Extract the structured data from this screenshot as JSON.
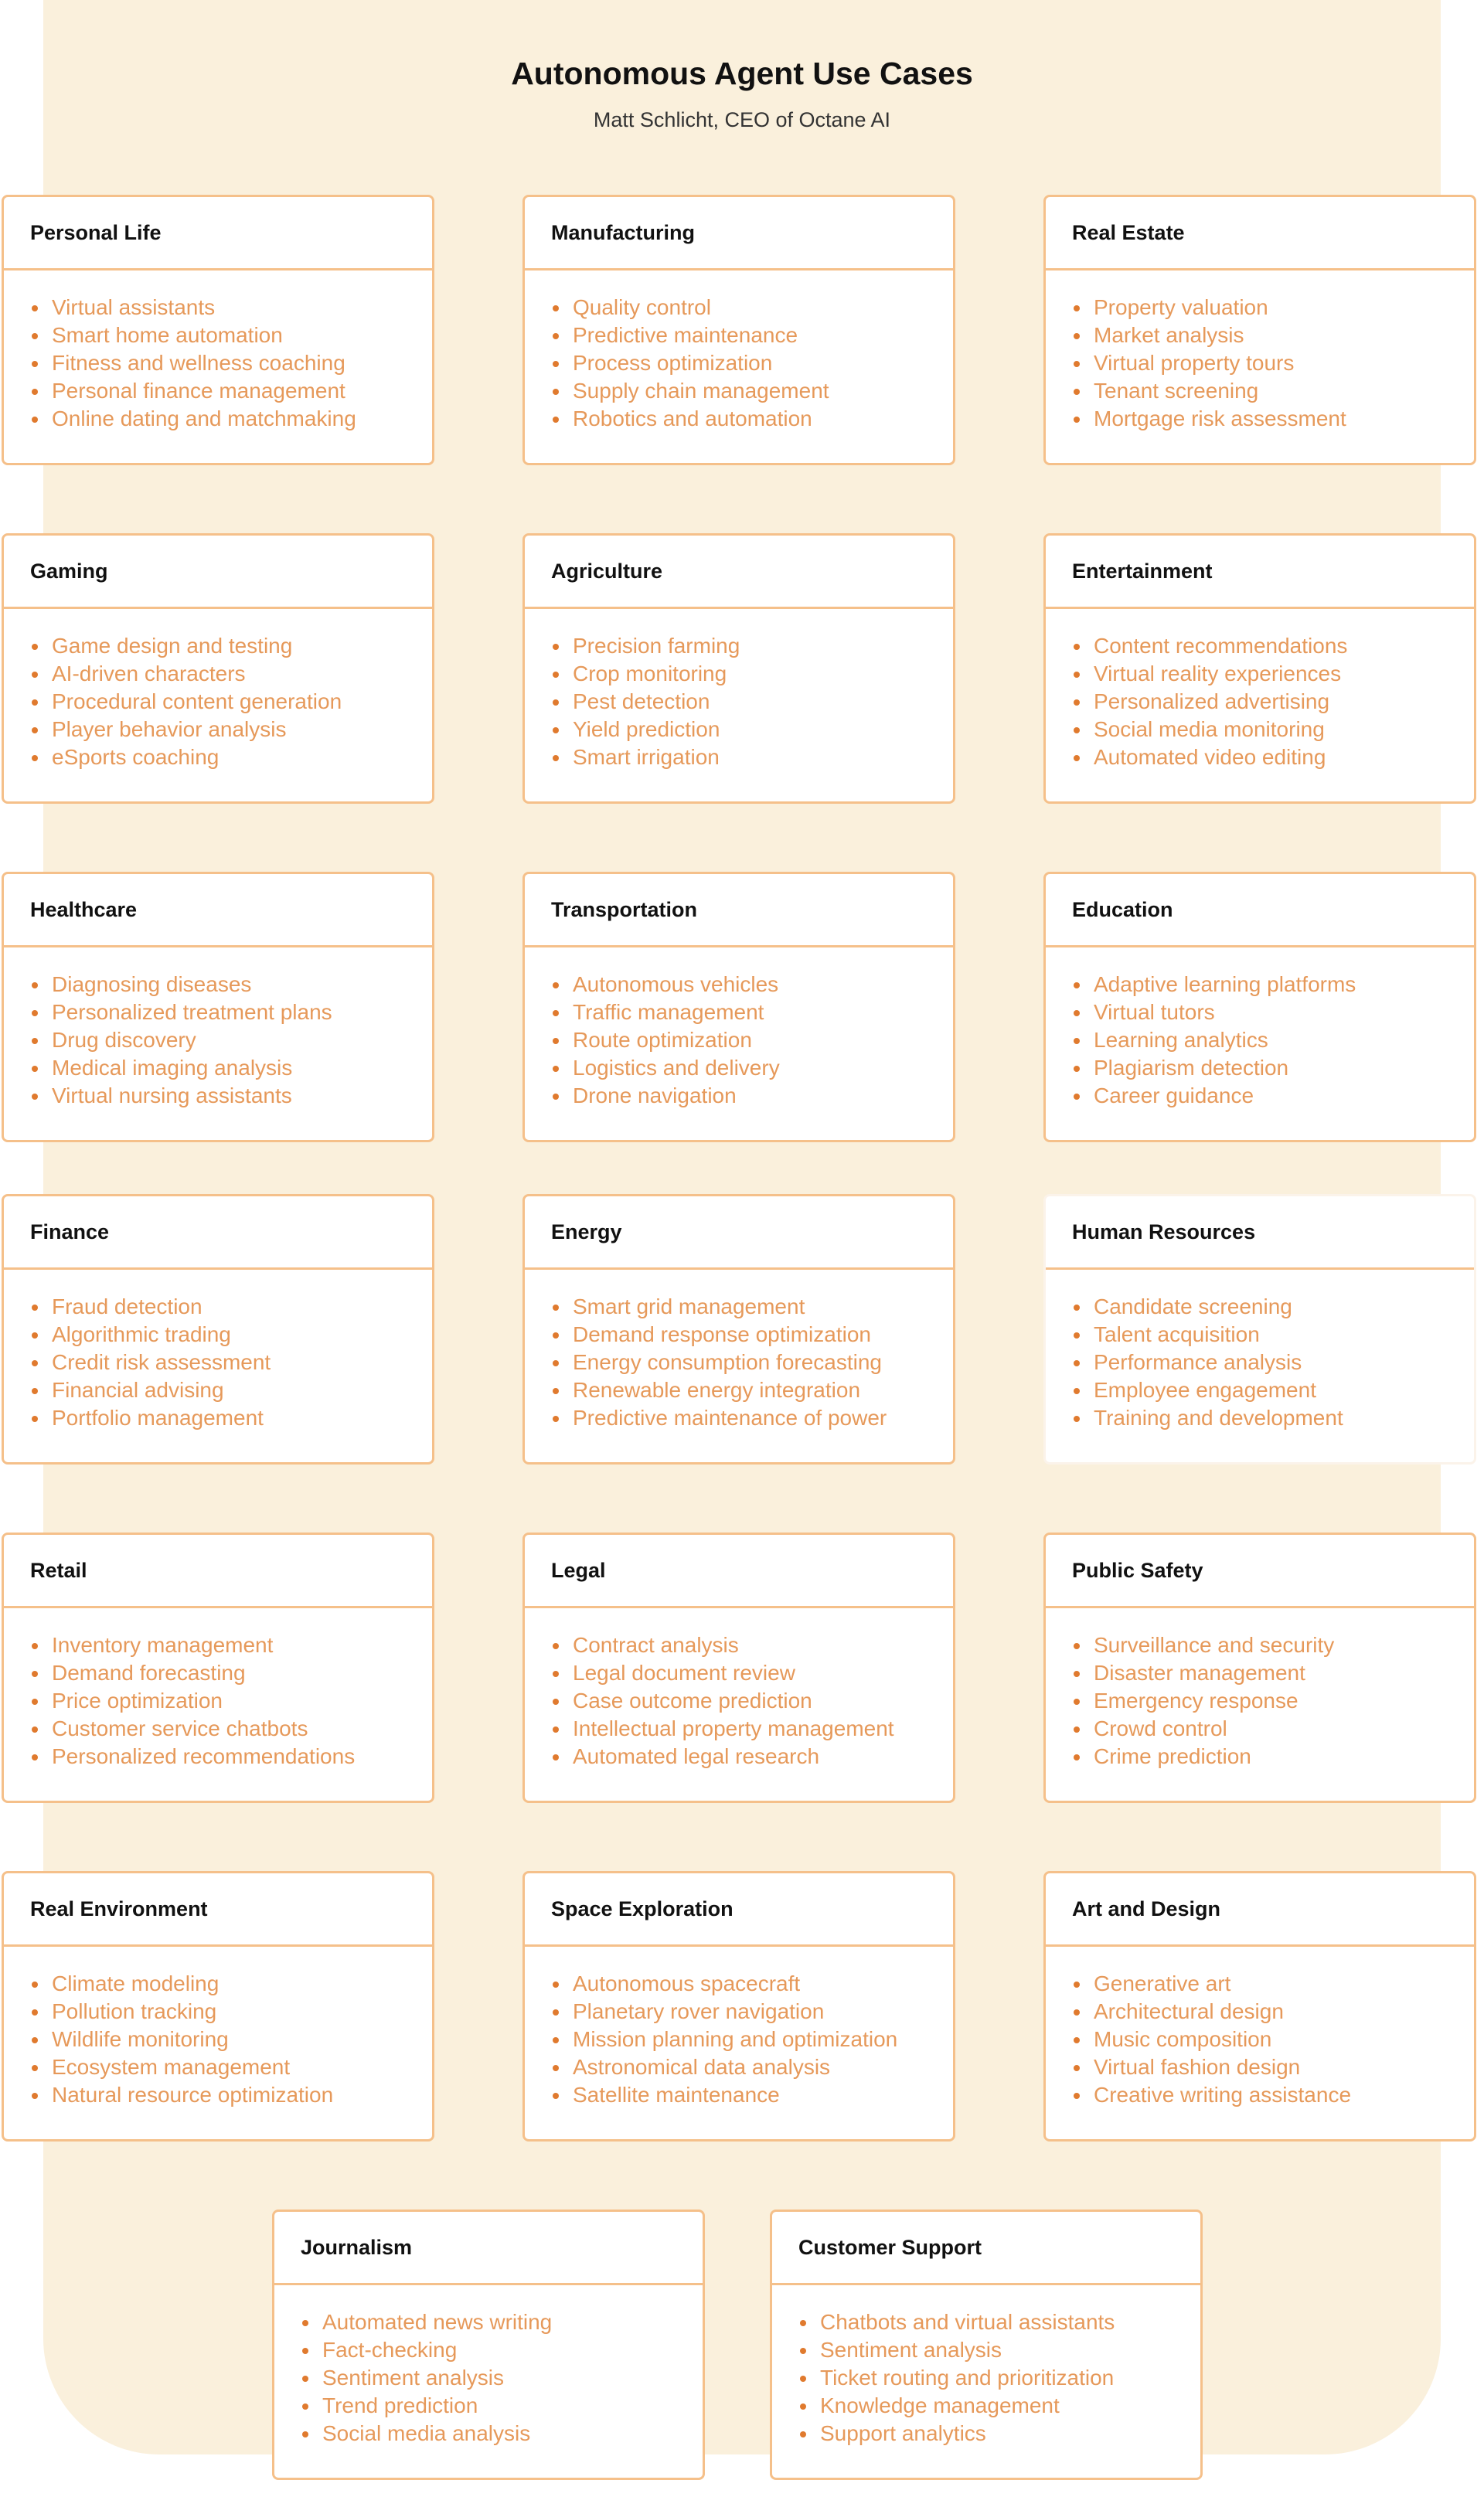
{
  "header": {
    "title": "Autonomous Agent Use Cases",
    "subtitle": "Matt Schlicht, CEO of Octane AI"
  },
  "colors": {
    "background_panel": "#faf0dc",
    "card_border": "#f5c08a",
    "item_text": "#e6995a",
    "bullet": "#e07a2e",
    "heading_text": "#111111"
  },
  "cards": [
    {
      "title": "Personal Life",
      "items": [
        "Virtual assistants",
        "Smart home automation",
        "Fitness and wellness coaching",
        "Personal finance management",
        "Online dating and matchmaking"
      ]
    },
    {
      "title": "Manufacturing",
      "items": [
        "Quality control",
        "Predictive maintenance",
        "Process optimization",
        "Supply chain management",
        "Robotics and automation"
      ]
    },
    {
      "title": "Real Estate",
      "items": [
        "Property valuation",
        "Market analysis",
        "Virtual property tours",
        "Tenant screening",
        "Mortgage risk assessment"
      ]
    },
    {
      "title": "Gaming",
      "items": [
        "Game design and testing",
        "AI-driven characters",
        "Procedural content generation",
        "Player behavior analysis",
        "eSports coaching"
      ]
    },
    {
      "title": "Agriculture",
      "items": [
        "Precision farming",
        "Crop monitoring",
        "Pest detection",
        "Yield prediction",
        "Smart irrigation"
      ]
    },
    {
      "title": "Entertainment",
      "items": [
        "Content recommendations",
        "Virtual reality experiences",
        "Personalized advertising",
        "Social media monitoring",
        "Automated video editing"
      ]
    },
    {
      "title": "Healthcare",
      "items": [
        "Diagnosing diseases",
        "Personalized treatment plans",
        "Drug discovery",
        "Medical imaging analysis",
        "Virtual nursing assistants"
      ]
    },
    {
      "title": "Transportation",
      "items": [
        "Autonomous vehicles",
        "Traffic management",
        "Route optimization",
        "Logistics and delivery",
        "Drone navigation"
      ]
    },
    {
      "title": "Education",
      "items": [
        "Adaptive learning platforms",
        "Virtual tutors",
        "Learning analytics",
        "Plagiarism detection",
        "Career guidance"
      ]
    },
    {
      "title": "Finance",
      "items": [
        "Fraud detection",
        "Algorithmic trading",
        "Credit risk assessment",
        "Financial advising",
        "Portfolio management"
      ]
    },
    {
      "title": "Energy",
      "items": [
        "Smart grid management",
        "Demand response optimization",
        "Energy consumption forecasting",
        "Renewable energy integration",
        "Predictive maintenance of power"
      ]
    },
    {
      "title": "Human Resources",
      "items": [
        "Candidate screening",
        "Talent acquisition",
        "Performance analysis",
        "Employee engagement",
        "Training and development"
      ]
    },
    {
      "title": "Retail",
      "items": [
        "Inventory management",
        "Demand forecasting",
        "Price optimization",
        "Customer service chatbots",
        "Personalized recommendations"
      ]
    },
    {
      "title": "Legal",
      "items": [
        "Contract analysis",
        "Legal document review",
        "Case outcome prediction",
        "Intellectual property management",
        "Automated legal research"
      ]
    },
    {
      "title": "Public Safety",
      "items": [
        "Surveillance and security",
        "Disaster management",
        "Emergency response",
        "Crowd control",
        "Crime prediction"
      ]
    },
    {
      "title": "Real Environment",
      "items": [
        "Climate modeling",
        "Pollution tracking",
        "Wildlife monitoring",
        "Ecosystem management",
        "Natural resource optimization"
      ]
    },
    {
      "title": "Space Exploration",
      "items": [
        "Autonomous spacecraft",
        "Planetary rover navigation",
        "Mission planning and optimization",
        "Astronomical data analysis",
        "Satellite maintenance"
      ]
    },
    {
      "title": "Art and Design",
      "items": [
        "Generative art",
        "Architectural design",
        "Music composition",
        "Virtual fashion design",
        "Creative writing assistance"
      ]
    },
    {
      "title": "Journalism",
      "items": [
        "Automated news writing",
        "Fact-checking",
        "Sentiment analysis",
        "Trend prediction",
        "Social media analysis"
      ]
    },
    {
      "title": "Customer Support",
      "items": [
        "Chatbots and virtual assistants",
        "Sentiment analysis",
        "Ticket routing and prioritization",
        "Knowledge management",
        "Support analytics"
      ]
    }
  ]
}
